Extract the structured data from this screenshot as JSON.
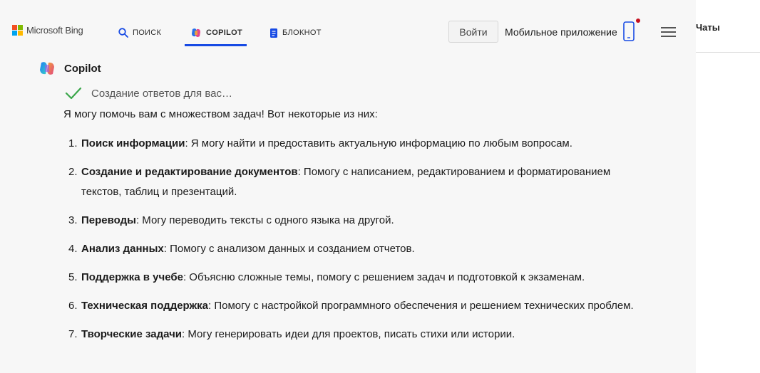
{
  "header": {
    "logo_text": "Microsoft Bing",
    "logo_colors": [
      "#f25022",
      "#7fba00",
      "#00a4ef",
      "#ffb900"
    ],
    "tabs": [
      {
        "label": "ПОИСК",
        "icon": "search-icon",
        "active": false
      },
      {
        "label": "COPILOT",
        "icon": "copilot-icon",
        "active": true
      },
      {
        "label": "БЛОКНОТ",
        "icon": "notebook-icon",
        "active": false
      }
    ],
    "login_label": "Войти",
    "mobile_app_label": "Мобильное приложение",
    "accent_color": "#174ae4"
  },
  "sidebar": {
    "title": "Чаты"
  },
  "chat": {
    "author": "Copilot",
    "status": "Создание ответов для вас…",
    "intro": "Я могу помочь вам с множеством задач! Вот некоторые из них:",
    "items": [
      {
        "num": "1.",
        "title": "Поиск информации",
        "text": ": Я могу найти и предоставить актуальную информацию по любым вопросам."
      },
      {
        "num": "2.",
        "title": "Создание и редактирование документов",
        "text": ": Помогу с написанием, редактированием и форматированием текстов, таблиц и презентаций."
      },
      {
        "num": "3.",
        "title": "Переводы",
        "text": ": Могу переводить тексты с одного языка на другой."
      },
      {
        "num": "4.",
        "title": "Анализ данных",
        "text": ": Помогу с анализом данных и созданием отчетов."
      },
      {
        "num": "5.",
        "title": "Поддержка в учебе",
        "text": ": Объясню сложные темы, помогу с решением задач и подготовкой к экзаменам."
      },
      {
        "num": "6.",
        "title": "Техническая поддержка",
        "text": ": Помогу с настройкой программного обеспечения и решением технических проблем."
      },
      {
        "num": "7.",
        "title": "Творческие задачи",
        "text": ": Могу генерировать идеи для проектов, писать стихи или истории."
      }
    ]
  }
}
